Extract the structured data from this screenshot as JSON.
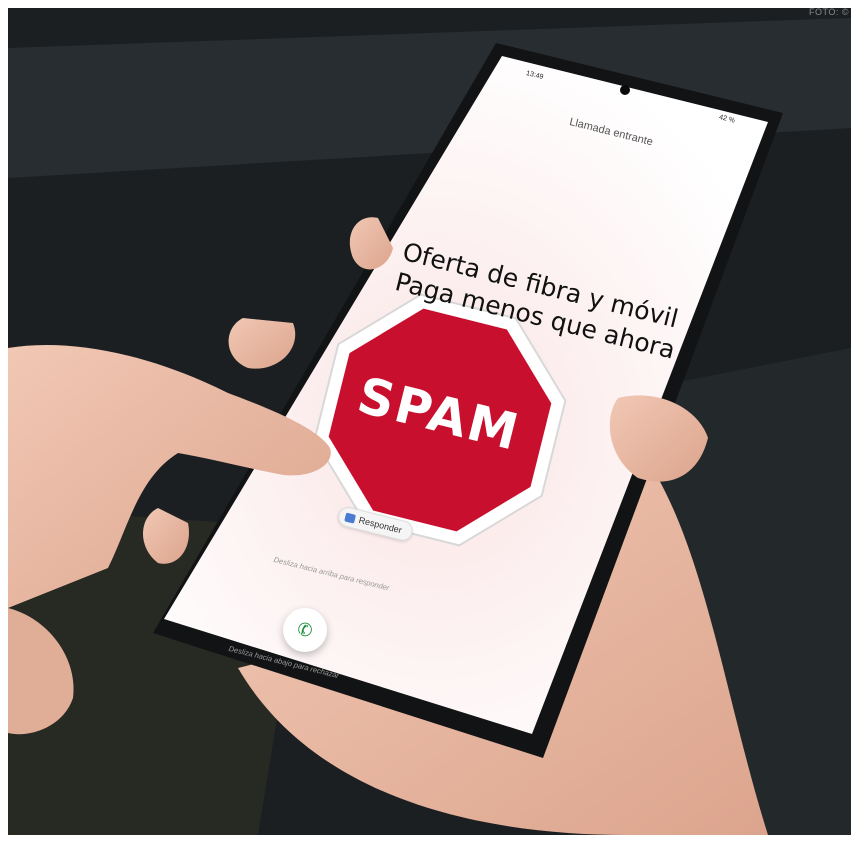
{
  "credit": "FOTO: ©",
  "status_bar": {
    "time": "13:49",
    "battery": "42 %"
  },
  "call": {
    "incoming_label": "Llamada entrante",
    "headline_line1": "Oferta de fibra y móvil",
    "headline_line2": "Paga menos que ahora",
    "spam_sign": "SPAM",
    "reply_label": "Responder",
    "swipe_up_hint": "Desliza hacia arriba para responder",
    "swipe_down_hint": "Desliza hacia abajo para rechazar",
    "answer_icon": "phone-icon"
  },
  "colors": {
    "stop_sign": "#c8102e",
    "answer_green": "#1e8e3e"
  }
}
